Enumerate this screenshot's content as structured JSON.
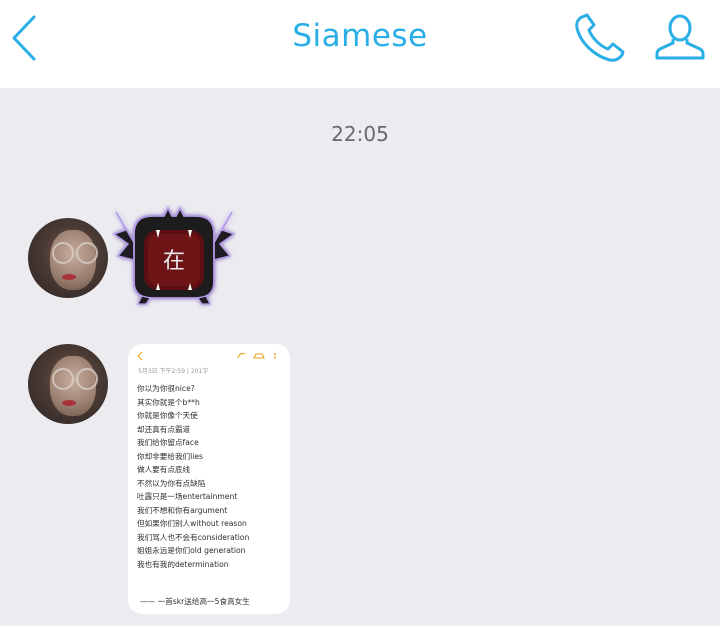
{
  "header": {
    "title": "Siamese",
    "back_icon": "chevron-left-icon",
    "call_icon": "phone-icon",
    "profile_icon": "person-icon",
    "accent_color": "#2aaee6"
  },
  "chat": {
    "timestamp": "22:05",
    "sticker": {
      "glyph": "在"
    },
    "image_message": {
      "meta": "5月3日 下午2:59 | 201字",
      "lines": [
        "你以为你很nice?",
        "其实你就是个b**h",
        "你就是你像个天使",
        "却还真有点霸道",
        "我们给你留点face",
        "你却非要给我们lies",
        "做人要有点底线",
        "不然以为你有点缺陷",
        "吐露只是一场entertainment",
        "我们不想和你有argument",
        "但如果你们别人without reason",
        "我们骂人也不会有consideration",
        "姐姐永远是你们old generation",
        "我也有我的determination"
      ],
      "signature": "—— 一首skr送给高一5食高女生"
    }
  }
}
